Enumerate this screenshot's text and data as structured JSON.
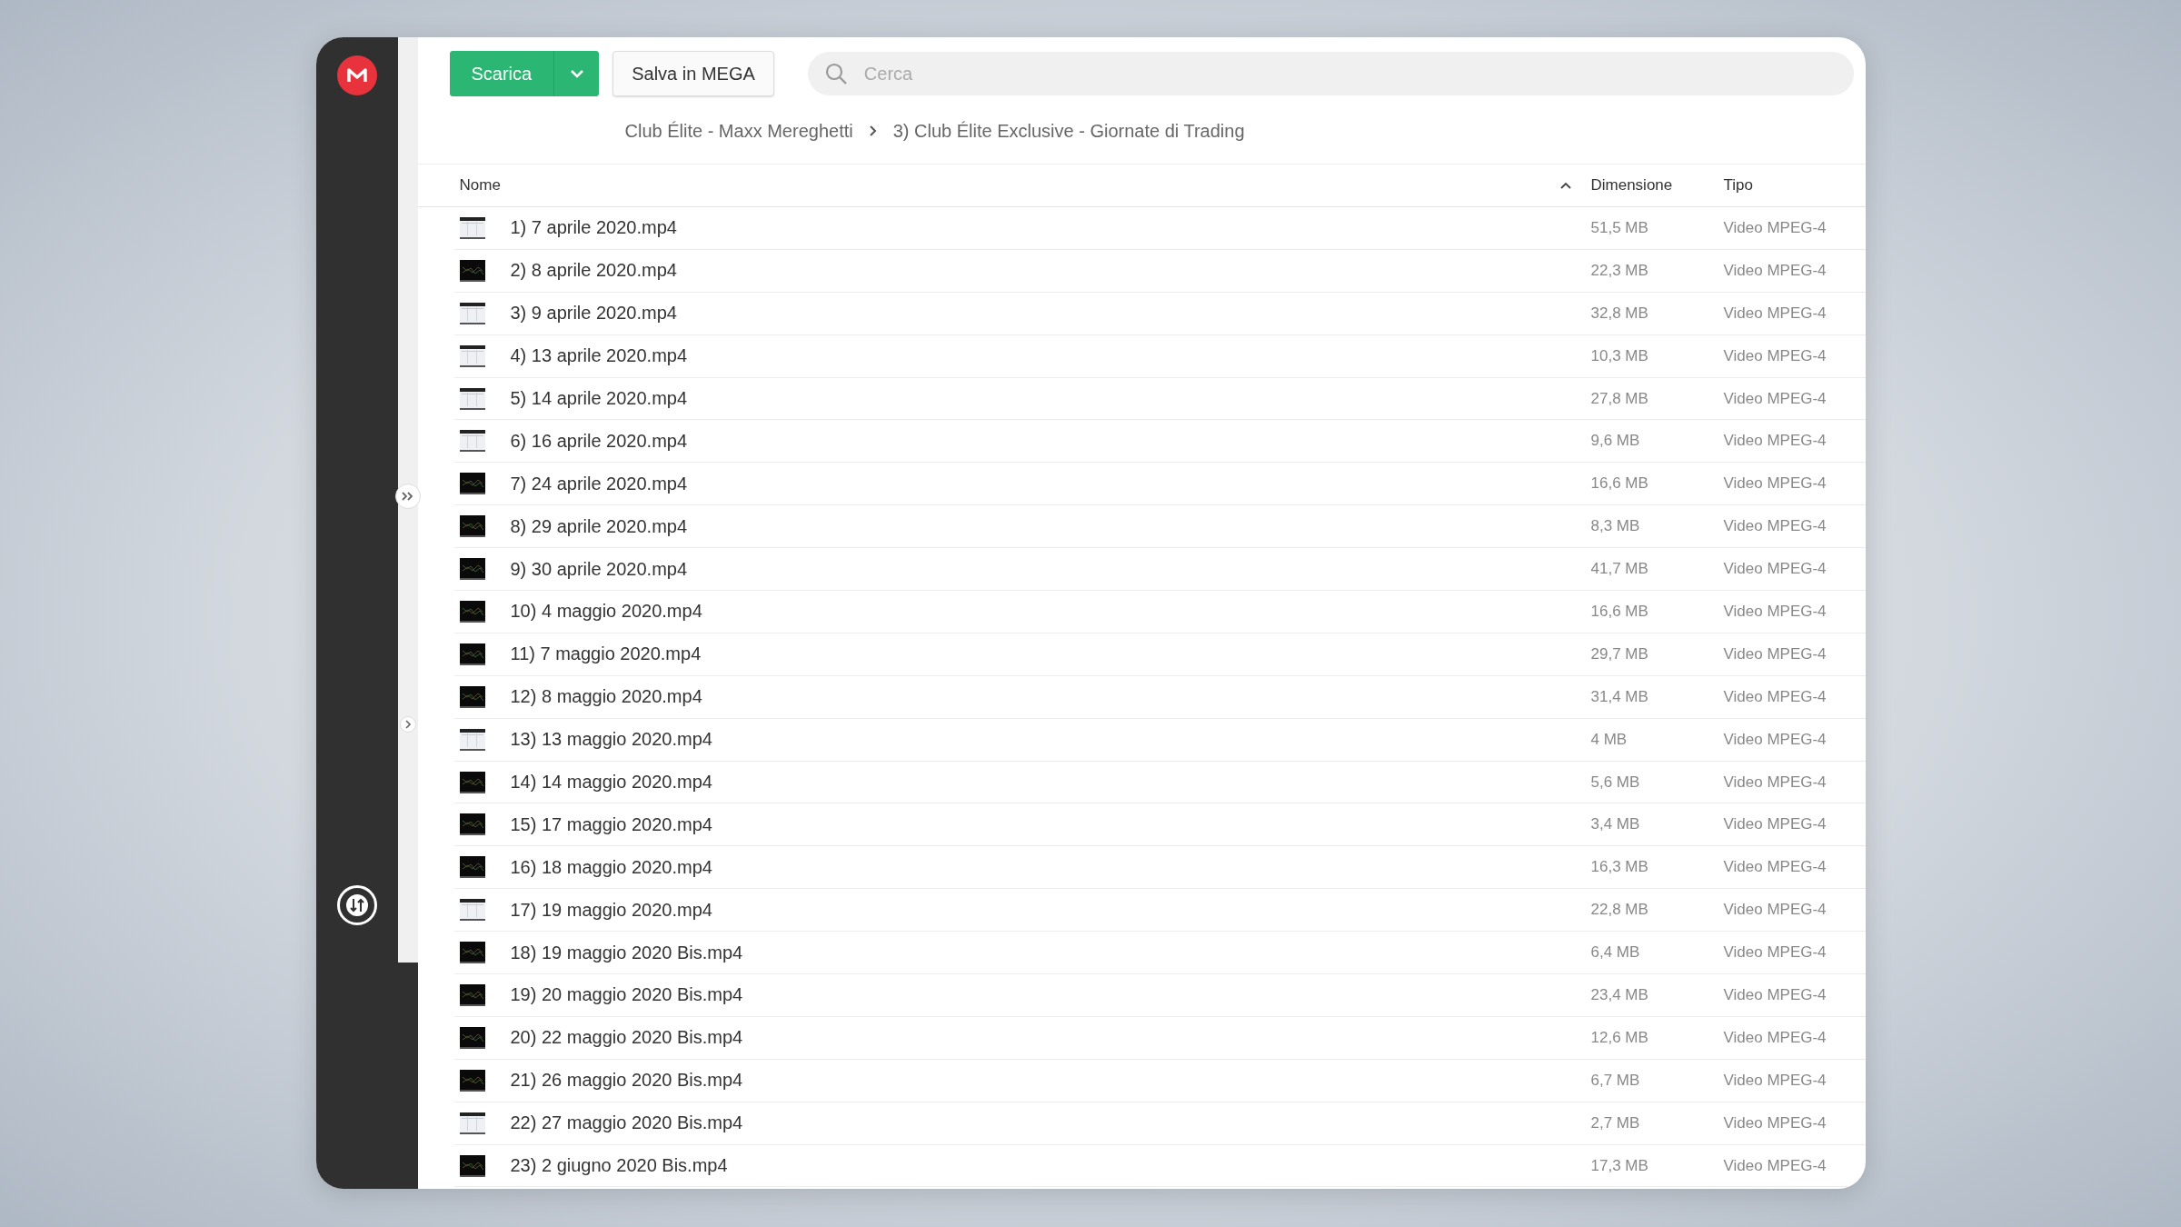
{
  "toolbar": {
    "download_button": "Scarica",
    "save_button": "Salva in MEGA",
    "search": {
      "placeholder": "Cerca"
    }
  },
  "breadcrumb": [
    "Club Élite - Maxx Mereghetti",
    "3) Club Élite Exclusive - Giornate di Trading"
  ],
  "table": {
    "columns": [
      "Nome",
      "Dimensione",
      "Tipo"
    ],
    "rows": [
      {
        "name": "1) 7 aprile 2020.mp4",
        "size": "51,5 MB",
        "type": "Video MPEG-4"
      },
      {
        "name": "2) 8 aprile 2020.mp4",
        "size": "22,3 MB",
        "type": "Video MPEG-4"
      },
      {
        "name": "3) 9 aprile 2020.mp4",
        "size": "32,8 MB",
        "type": "Video MPEG-4"
      },
      {
        "name": "4) 13 aprile 2020.mp4",
        "size": "10,3 MB",
        "type": "Video MPEG-4"
      },
      {
        "name": "5) 14 aprile 2020.mp4",
        "size": "27,8 MB",
        "type": "Video MPEG-4"
      },
      {
        "name": "6) 16 aprile 2020.mp4",
        "size": "9,6 MB",
        "type": "Video MPEG-4"
      },
      {
        "name": "7) 24 aprile 2020.mp4",
        "size": "16,6 MB",
        "type": "Video MPEG-4"
      },
      {
        "name": "8) 29 aprile 2020.mp4",
        "size": "8,3 MB",
        "type": "Video MPEG-4"
      },
      {
        "name": "9) 30 aprile 2020.mp4",
        "size": "41,7 MB",
        "type": "Video MPEG-4"
      },
      {
        "name": "10) 4 maggio 2020.mp4",
        "size": "16,6 MB",
        "type": "Video MPEG-4"
      },
      {
        "name": "11) 7 maggio 2020.mp4",
        "size": "29,7 MB",
        "type": "Video MPEG-4"
      },
      {
        "name": "12) 8 maggio 2020.mp4",
        "size": "31,4 MB",
        "type": "Video MPEG-4"
      },
      {
        "name": "13) 13 maggio 2020.mp4",
        "size": "4 MB",
        "type": "Video MPEG-4"
      },
      {
        "name": "14) 14 maggio 2020.mp4",
        "size": "5,6 MB",
        "type": "Video MPEG-4"
      },
      {
        "name": "15) 17 maggio 2020.mp4",
        "size": "3,4 MB",
        "type": "Video MPEG-4"
      },
      {
        "name": "16) 18 maggio 2020.mp4",
        "size": "16,3 MB",
        "type": "Video MPEG-4"
      },
      {
        "name": "17) 19 maggio 2020.mp4",
        "size": "22,8 MB",
        "type": "Video MPEG-4"
      },
      {
        "name": "18) 19 maggio 2020 Bis.mp4",
        "size": "6,4 MB",
        "type": "Video MPEG-4"
      },
      {
        "name": "19) 20 maggio 2020 Bis.mp4",
        "size": "23,4 MB",
        "type": "Video MPEG-4"
      },
      {
        "name": "20) 22 maggio 2020 Bis.mp4",
        "size": "12,6 MB",
        "type": "Video MPEG-4"
      },
      {
        "name": "21) 26 maggio 2020 Bis.mp4",
        "size": "6,7 MB",
        "type": "Video MPEG-4"
      },
      {
        "name": "22) 27 maggio 2020 Bis.mp4",
        "size": "2,7 MB",
        "type": "Video MPEG-4"
      },
      {
        "name": "23) 2 giugno 2020 Bis.mp4",
        "size": "17,3 MB",
        "type": "Video MPEG-4"
      }
    ]
  }
}
